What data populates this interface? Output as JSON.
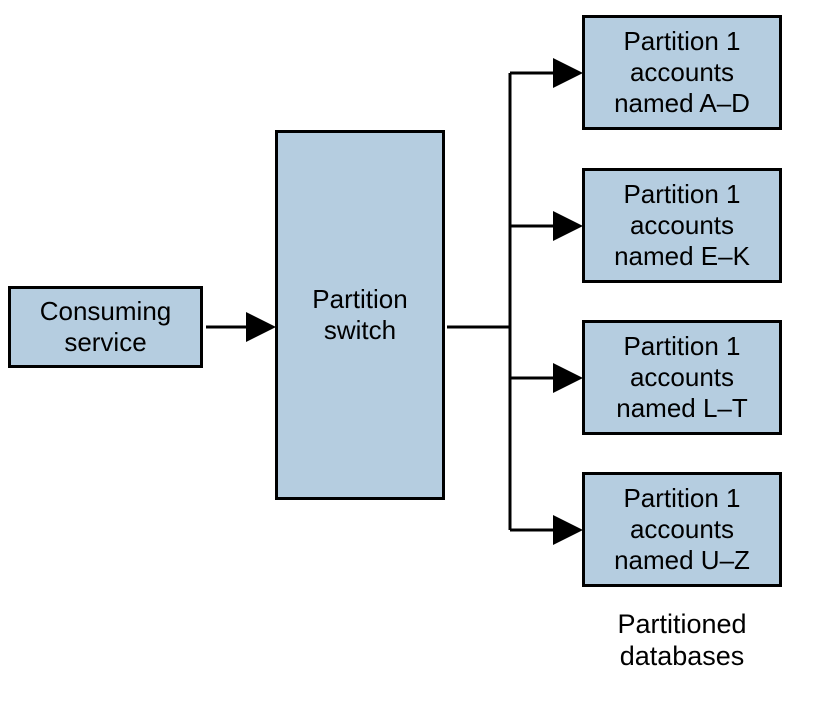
{
  "nodes": {
    "consuming_service": "Consuming\nservice",
    "partition_switch": "Partition\nswitch",
    "partition_1": "Partition 1\naccounts\nnamed A–D",
    "partition_2": "Partition 1\naccounts\nnamed E–K",
    "partition_3": "Partition 1\naccounts\nnamed L–T",
    "partition_4": "Partition 1\naccounts\nnamed U–Z"
  },
  "caption": "Partitioned\ndatabases",
  "edges": [
    {
      "from": "consuming_service",
      "to": "partition_switch"
    },
    {
      "from": "partition_switch",
      "to": "partition_1"
    },
    {
      "from": "partition_switch",
      "to": "partition_2"
    },
    {
      "from": "partition_switch",
      "to": "partition_3"
    },
    {
      "from": "partition_switch",
      "to": "partition_4"
    }
  ],
  "colors": {
    "box_fill": "#b5cde0",
    "box_stroke": "#000000"
  }
}
